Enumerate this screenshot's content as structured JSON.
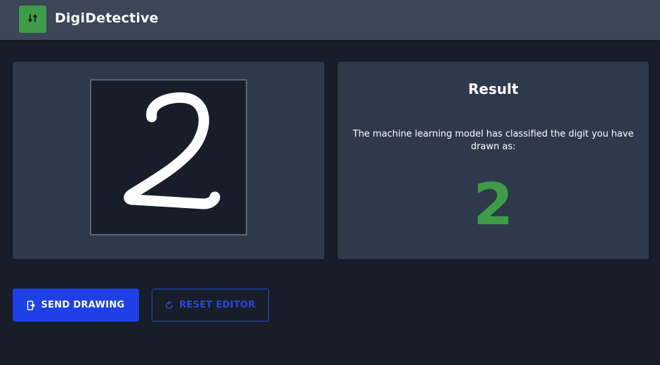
{
  "app": {
    "title": "DigiDetective",
    "logo_icon": "sort-arrows-icon",
    "accent_color": "#3e9c48"
  },
  "drawing": {
    "drawn_digit": "2",
    "stroke_color": "#ffffff"
  },
  "result": {
    "title": "Result",
    "description": "The machine learning model has classified the digit you have drawn as:",
    "digit": "2",
    "digit_color": "#3e9c48"
  },
  "actions": {
    "send_label": "SEND DRAWING",
    "send_icon": "send-to-device-icon",
    "reset_label": "RESET EDITOR",
    "reset_icon": "refresh-icon",
    "primary_color": "#1e40e6"
  }
}
